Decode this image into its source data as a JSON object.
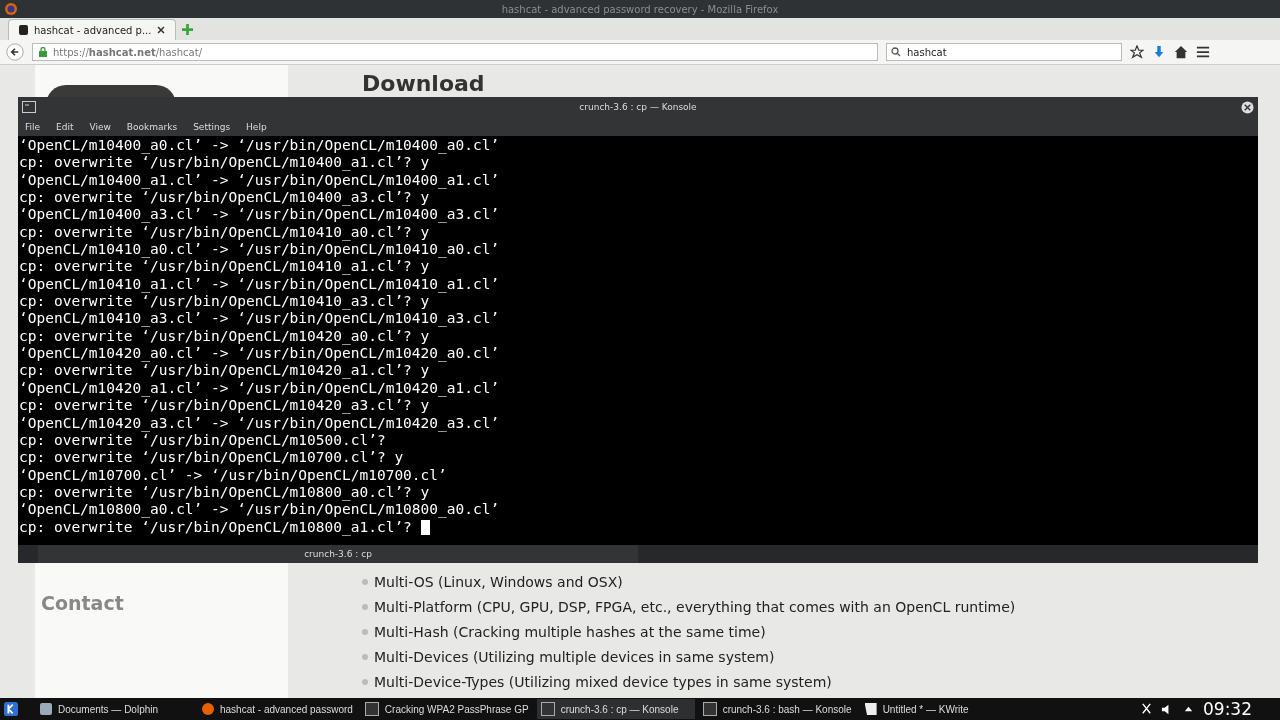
{
  "browser": {
    "title": "hashcat - advanced password recovery - Mozilla Firefox",
    "tabs": [
      {
        "label": "hashcat - advanced p...",
        "selected": true
      }
    ],
    "url": "https://**hashcat.net**/hashcat/",
    "search": {
      "value": "hashcat"
    }
  },
  "page": {
    "heading": "Download",
    "sidebar_link": "Contact",
    "features": [
      "Multi-OS (Linux, Windows and OSX)",
      "Multi-Platform (CPU, GPU, DSP, FPGA, etc., everything that comes with an OpenCL runtime)",
      "Multi-Hash (Cracking multiple hashes at the same time)",
      "Multi-Devices (Utilizing multiple devices in same system)",
      "Multi-Device-Types (Utilizing mixed device types in same system)"
    ]
  },
  "konsole": {
    "title": "crunch-3.6 : cp — Konsole",
    "menu": [
      "File",
      "Edit",
      "View",
      "Bookmarks",
      "Settings",
      "Help"
    ],
    "lines": [
      "‘OpenCL/m10400_a0.cl’ -> ‘/usr/bin/OpenCL/m10400_a0.cl’",
      "cp: overwrite ‘/usr/bin/OpenCL/m10400_a1.cl’? y",
      "‘OpenCL/m10400_a1.cl’ -> ‘/usr/bin/OpenCL/m10400_a1.cl’",
      "cp: overwrite ‘/usr/bin/OpenCL/m10400_a3.cl’? y",
      "‘OpenCL/m10400_a3.cl’ -> ‘/usr/bin/OpenCL/m10400_a3.cl’",
      "cp: overwrite ‘/usr/bin/OpenCL/m10410_a0.cl’? y",
      "‘OpenCL/m10410_a0.cl’ -> ‘/usr/bin/OpenCL/m10410_a0.cl’",
      "cp: overwrite ‘/usr/bin/OpenCL/m10410_a1.cl’? y",
      "‘OpenCL/m10410_a1.cl’ -> ‘/usr/bin/OpenCL/m10410_a1.cl’",
      "cp: overwrite ‘/usr/bin/OpenCL/m10410_a3.cl’? y",
      "‘OpenCL/m10410_a3.cl’ -> ‘/usr/bin/OpenCL/m10410_a3.cl’",
      "cp: overwrite ‘/usr/bin/OpenCL/m10420_a0.cl’? y",
      "‘OpenCL/m10420_a0.cl’ -> ‘/usr/bin/OpenCL/m10420_a0.cl’",
      "cp: overwrite ‘/usr/bin/OpenCL/m10420_a1.cl’? y",
      "‘OpenCL/m10420_a1.cl’ -> ‘/usr/bin/OpenCL/m10420_a1.cl’",
      "cp: overwrite ‘/usr/bin/OpenCL/m10420_a3.cl’? y",
      "‘OpenCL/m10420_a3.cl’ -> ‘/usr/bin/OpenCL/m10420_a3.cl’",
      "cp: overwrite ‘/usr/bin/OpenCL/m10500.cl’?",
      "cp: overwrite ‘/usr/bin/OpenCL/m10700.cl’? y",
      "‘OpenCL/m10700.cl’ -> ‘/usr/bin/OpenCL/m10700.cl’",
      "cp: overwrite ‘/usr/bin/OpenCL/m10800_a0.cl’? y",
      "‘OpenCL/m10800_a0.cl’ -> ‘/usr/bin/OpenCL/m10800_a0.cl’",
      "cp: overwrite ‘/usr/bin/OpenCL/m10800_a1.cl’?"
    ],
    "tabs": [
      {
        "label": "crunch-3.6 : cp",
        "selected": true
      }
    ]
  },
  "taskbar": {
    "items": [
      {
        "label": "Documents — Dolphin",
        "kind": "folder",
        "selected": false
      },
      {
        "label": "hashcat - advanced password",
        "kind": "browser",
        "selected": false
      },
      {
        "label": "Cracking WPA2 PassPhrase GP",
        "kind": "terminal",
        "selected": false
      },
      {
        "label": "crunch-3.6 : cp — Konsole",
        "kind": "terminal",
        "selected": true
      },
      {
        "label": "crunch-3.6 : bash — Konsole",
        "kind": "terminal",
        "selected": false
      },
      {
        "label": "Untitled * — KWrite",
        "kind": "editor",
        "selected": false
      }
    ],
    "clock": "09:32"
  }
}
